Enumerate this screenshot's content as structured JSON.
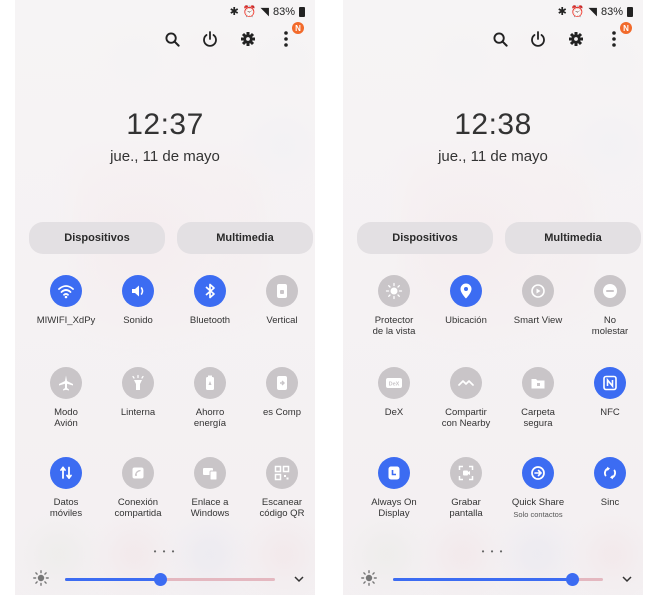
{
  "status_bar": {
    "battery": "83%"
  },
  "panels": [
    {
      "clock": "12:37",
      "date": "jue., 11 de mayo",
      "buttons": {
        "devices": "Dispositivos",
        "media": "Multimedia"
      },
      "notification_badge": "N",
      "page_indicator": "• • •",
      "brightness": {
        "level": 0.45
      },
      "tiles": [
        {
          "label": "MIWIFI_XdPy",
          "icon": "wifi-icon",
          "state": "on"
        },
        {
          "label": "Sonido",
          "icon": "sound-icon",
          "state": "on"
        },
        {
          "label": "Bluetooth",
          "icon": "bluetooth-icon",
          "state": "on"
        },
        {
          "label": "Vertical",
          "icon": "portrait-lock-icon",
          "state": "off"
        },
        {
          "label": "Modo\nAvión",
          "icon": "airplane-icon",
          "state": "off"
        },
        {
          "label": "Linterna",
          "icon": "flashlight-icon",
          "state": "off"
        },
        {
          "label": "Ahorro\nenergía",
          "icon": "power-saving-icon",
          "state": "off"
        },
        {
          "label": "es      Comp",
          "icon": "exit-icon",
          "state": "off"
        },
        {
          "label": "Datos\nmóviles",
          "icon": "mobile-data-icon",
          "state": "on"
        },
        {
          "label": "Conexión\ncompartida",
          "icon": "hotspot-icon",
          "state": "off"
        },
        {
          "label": "Enlace a\nWindows",
          "icon": "link-windows-icon",
          "state": "off"
        },
        {
          "label": "Escanear\ncódigo QR",
          "icon": "qr-code-icon",
          "state": "off"
        }
      ]
    },
    {
      "clock": "12:38",
      "date": "jue., 11 de mayo",
      "buttons": {
        "devices": "Dispositivos",
        "media": "Multimedia"
      },
      "notification_badge": "N",
      "page_indicator": "• • •",
      "brightness": {
        "level": 0.85
      },
      "tiles": [
        {
          "label": "Protector\nde la vista",
          "icon": "eye-comfort-icon",
          "state": "off"
        },
        {
          "label": "Ubicación",
          "icon": "location-icon",
          "state": "on"
        },
        {
          "label": "Smart View",
          "icon": "smart-view-icon",
          "state": "off"
        },
        {
          "label": "No\nmolestar",
          "icon": "do-not-disturb-icon",
          "state": "off"
        },
        {
          "label": "DeX",
          "icon": "dex-icon",
          "state": "off"
        },
        {
          "label": "Compartir\ncon Nearby",
          "icon": "nearby-share-icon",
          "state": "off"
        },
        {
          "label": "Carpeta\nsegura",
          "icon": "secure-folder-icon",
          "state": "off"
        },
        {
          "label": "NFC",
          "icon": "nfc-icon",
          "state": "on"
        },
        {
          "label": "Always On\nDisplay",
          "icon": "always-on-display-icon",
          "state": "on"
        },
        {
          "label": "Grabar\npantalla",
          "icon": "screen-record-icon",
          "state": "off"
        },
        {
          "label": "Quick Share",
          "sub": "Solo contactos",
          "icon": "quick-share-icon",
          "state": "on"
        },
        {
          "label": "Sinc",
          "icon": "sync-icon",
          "state": "on"
        }
      ]
    }
  ]
}
